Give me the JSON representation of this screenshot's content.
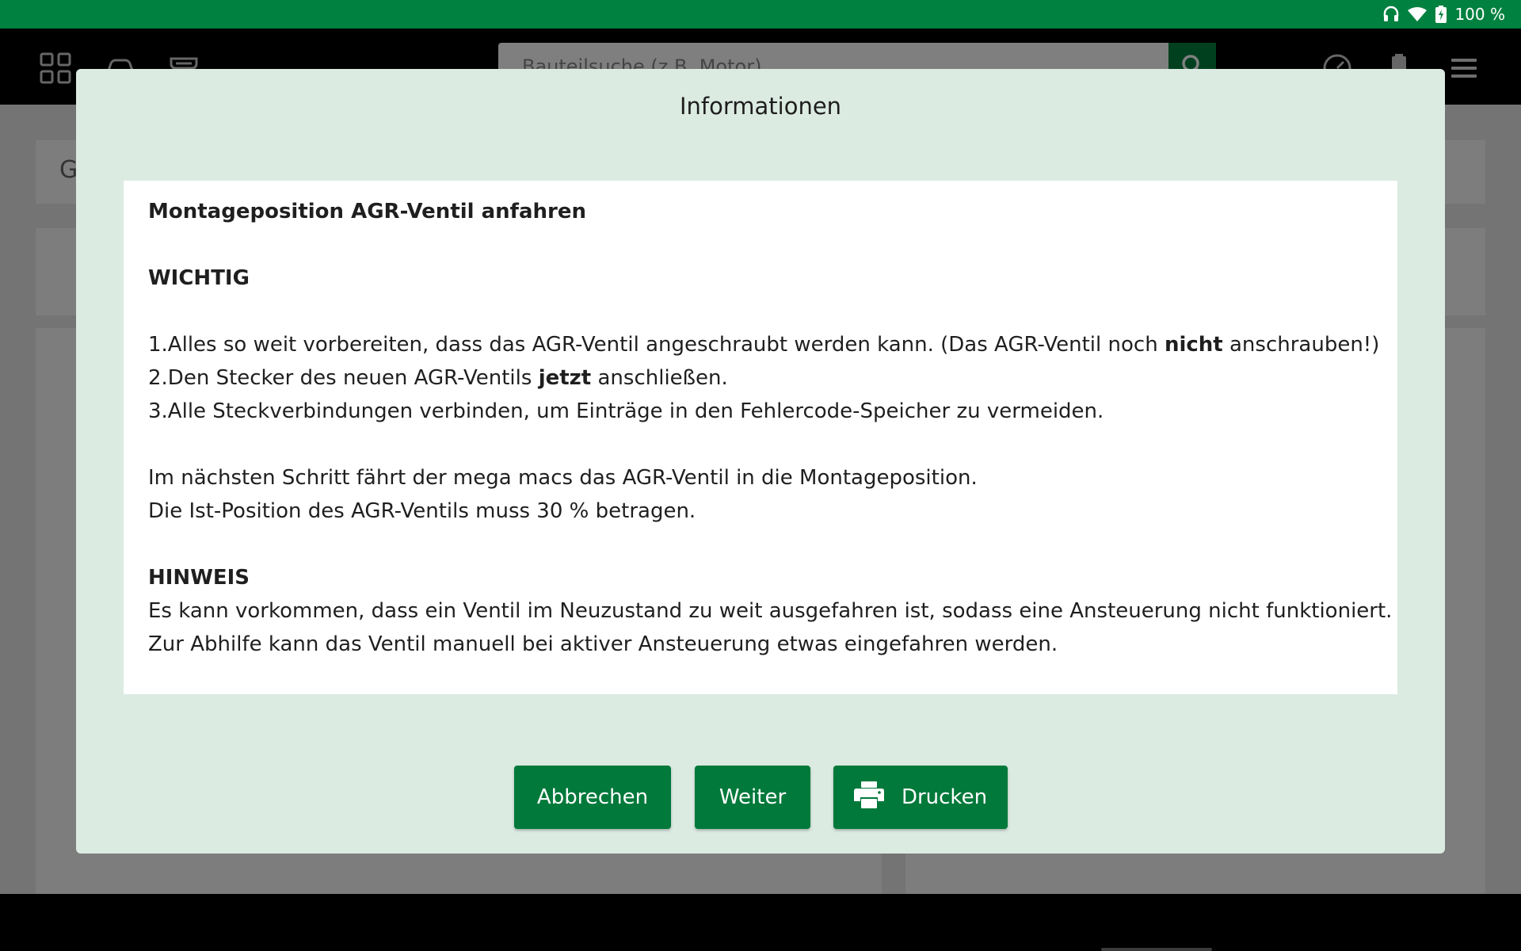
{
  "status_bar": {
    "battery_text": "100 %",
    "icons": [
      "headset-icon",
      "wifi-icon",
      "battery-charging-icon"
    ],
    "color": "#00813f"
  },
  "header": {
    "search": {
      "placeholder": "Bauteilsuche (z.B. Motor)",
      "value": ""
    },
    "left_icons": [
      "grid-icon",
      "car-icon",
      "service-icon"
    ],
    "right_icons": [
      "gauge-icon",
      "battery-test-icon",
      "menu-icon"
    ]
  },
  "background": {
    "panel_initial": "G"
  },
  "dialog": {
    "title": "Informationen",
    "body": {
      "heading": "Montageposition AGR-Ventil anfahren",
      "important_label": "WICHTIG",
      "step1": {
        "before": "1.Alles so weit vorbereiten, dass das AGR-Ventil angeschraubt werden kann. (Das AGR-Ventil noch ",
        "bold": "nicht",
        "after": " anschrauben!)"
      },
      "step2": {
        "before": "2.Den Stecker des neuen AGR-Ventils ",
        "bold": "jetzt",
        "after": " anschließen."
      },
      "step3": "3.Alle Steckverbindungen verbinden, um Einträge in den Fehlercode-Speicher zu vermeiden.",
      "next_step": "Im nächsten Schritt fährt der mega macs das AGR-Ventil in die Montageposition.",
      "position": "Die Ist-Position des AGR-Ventils muss 30 % betragen.",
      "note_label": "HINWEIS",
      "note_line1": "Es kann vorkommen, dass ein Ventil im Neuzustand zu weit ausgefahren ist, sodass eine Ansteuerung nicht funktioniert.",
      "note_line2": "Zur Abhilfe kann das Ventil manuell bei aktiver Ansteuerung etwas eingefahren werden."
    },
    "buttons": {
      "cancel": "Abbrechen",
      "next": "Weiter",
      "print": "Drucken",
      "print_icon": "printer-icon"
    },
    "colors": {
      "dialog_bg": "#dbebe2",
      "button_bg": "#00793a"
    }
  }
}
